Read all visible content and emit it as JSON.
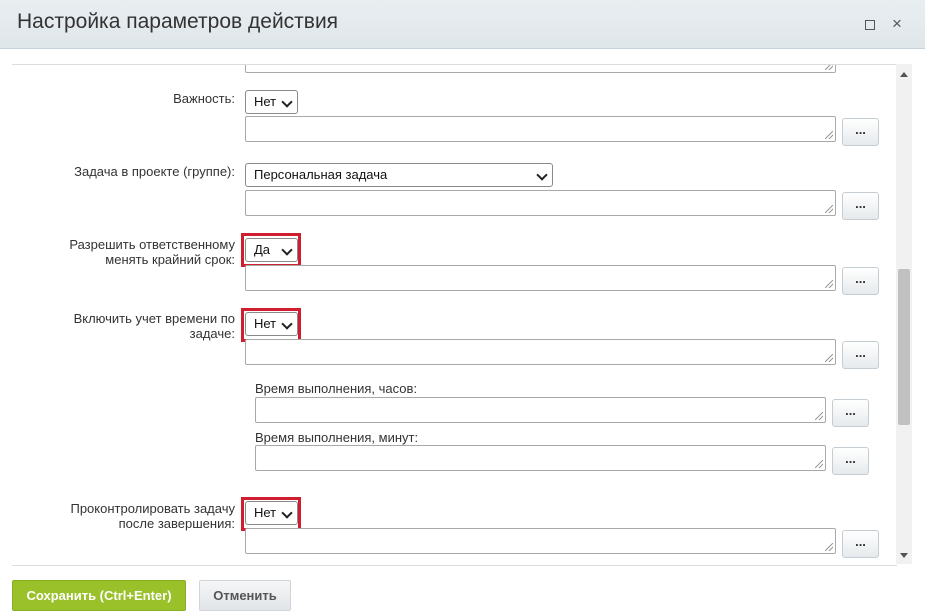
{
  "dialog": {
    "title": "Настройка параметров действия",
    "maximize_icon": "maximize-icon",
    "close_glyph": "×"
  },
  "fields": [
    {
      "label": "Важность:",
      "value": "Нет",
      "button": "..."
    },
    {
      "label": "Задача в проекте (группе):",
      "value": "Персональная задача",
      "button": "..."
    },
    {
      "label": "Разрешить ответственному менять крайний срок:",
      "value": "Да",
      "button": "...",
      "highlighted": true
    },
    {
      "label": "Включить учет времени по задаче:",
      "value": "Нет",
      "button": "...",
      "highlighted": true
    },
    {
      "label": "Проконтролировать задачу после завершения:",
      "value": "Нет",
      "button": "...",
      "highlighted": true
    }
  ],
  "time_fields": [
    {
      "label": "Время выполнения, часов:",
      "button": "..."
    },
    {
      "label": "Время выполнения, минут:",
      "button": "..."
    }
  ],
  "footer": {
    "save_label": "Сохранить (Ctrl+Enter)",
    "cancel_label": "Отменить"
  },
  "colors": {
    "save_button": "#9ac12a",
    "highlight_border": "#cf1f2e",
    "titlebar": "#e3e9ed"
  }
}
